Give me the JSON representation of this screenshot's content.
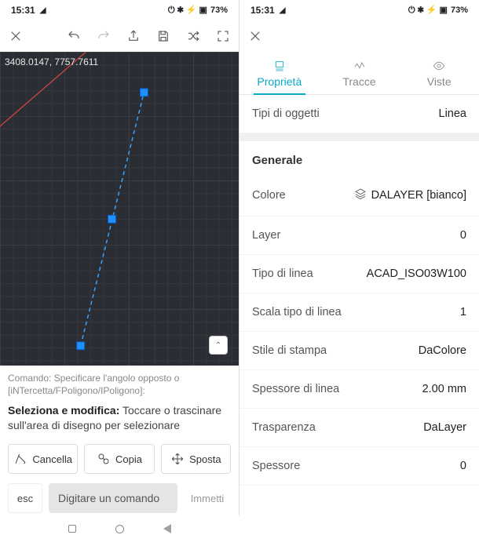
{
  "status": {
    "time": "15:31",
    "battery": "73%",
    "icons": "⌵ ⚡ ⧉ ▣"
  },
  "coords": "3408.0147, 7757.7611",
  "cmd_history": "Comando: Specificare l'angolo opposto o [iNTercetta/FPoligono/IPoligono]:",
  "prompt_bold": "Seleziona e modifica:",
  "prompt_rest": " Toccare o trascinare sull'area di disegno per selezionare",
  "actions": {
    "delete": "Cancella",
    "copy": "Copia",
    "move": "Sposta"
  },
  "cmd": {
    "esc": "esc",
    "placeholder": "Digitare un comando",
    "enter": "Immetti"
  },
  "tabs": {
    "props": "Proprietà",
    "traces": "Tracce",
    "views": "Viste"
  },
  "props": {
    "object_types_label": "Tipi di oggetti",
    "object_types_value": "Linea",
    "general": "Generale",
    "color_label": "Colore",
    "color_value": "DALAYER [bianco]",
    "layer_label": "Layer",
    "layer_value": "0",
    "linetype_label": "Tipo di linea",
    "linetype_value": "ACAD_ISO03W100",
    "ltscale_label": "Scala tipo di linea",
    "ltscale_value": "1",
    "plotstyle_label": "Stile di stampa",
    "plotstyle_value": "DaColore",
    "lineweight_label": "Spessore di linea",
    "lineweight_value": "2.00 mm",
    "transparency_label": "Trasparenza",
    "transparency_value": "DaLayer",
    "thickness_label": "Spessore",
    "thickness_value": "0"
  }
}
